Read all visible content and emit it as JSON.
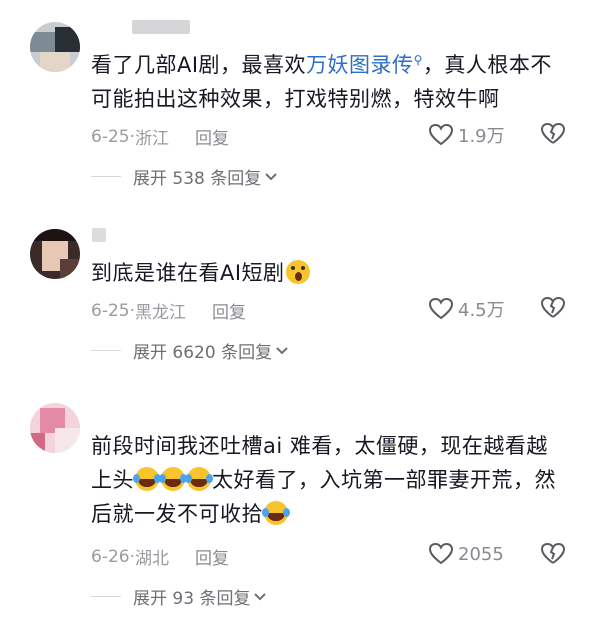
{
  "comments": [
    {
      "text_before": "看了几部AI剧，最喜欢",
      "link": "万妖图录传",
      "search_mark": "🔍",
      "text_after": "，真人根本不可能拍出这种效果，打戏特别燃，特效牛啊",
      "date": "6-25",
      "location": "浙江",
      "reply_label": "回复",
      "likes": "1.9万",
      "expand_label": "展开 538 条回复"
    },
    {
      "text": "到底是谁在看AI短剧",
      "emoji": "shock",
      "date": "6-25",
      "location": "黑龙江",
      "reply_label": "回复",
      "likes": "4.5万",
      "expand_label": "展开 6620 条回复"
    },
    {
      "text_part1": "前段时间我还吐槽ai 难看，太僵硬，现在越看越上头",
      "text_part2": "太好看了，入坑第一部罪妻开荒，然后就一发不可收拾",
      "emoji": "laugh",
      "date": "6-26",
      "location": "湖北",
      "reply_label": "回复",
      "likes": "2055",
      "expand_label": "展开 93 条回复"
    }
  ],
  "colors": {
    "text": "#161823",
    "meta": "#9a9ba0",
    "link": "#2d6fc9"
  }
}
